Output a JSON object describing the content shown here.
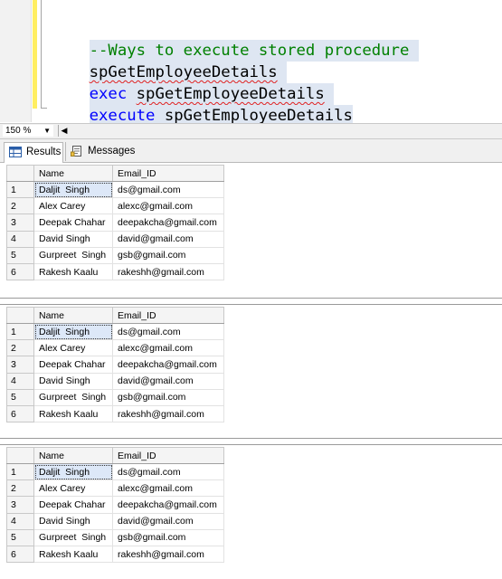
{
  "editor": {
    "lines": {
      "comment": "--Ways to execute stored procedure",
      "line2_proc": "spGetEmployeeDetails",
      "line3_kw": "exec",
      "line3_proc": "spGetEmployeeDetails",
      "line4_kw": "execute",
      "line4_proc": "spGetEmployeeDetails"
    }
  },
  "zoom": {
    "value": "150 %"
  },
  "tabs": {
    "results": "Results",
    "messages": "Messages"
  },
  "grids": {
    "columns": [
      "Name",
      "Email_ID"
    ],
    "g1": {
      "rows": [
        {
          "n": "1",
          "name": "Daljit  Singh",
          "email": "ds@gmail.com"
        },
        {
          "n": "2",
          "name": "Alex Carey",
          "email": "alexc@gmail.com"
        },
        {
          "n": "3",
          "name": "Deepak Chahar",
          "email": "deepakcha@gmail.com"
        },
        {
          "n": "4",
          "name": "David Singh",
          "email": "david@gmail.com"
        },
        {
          "n": "5",
          "name": "Gurpreet  Singh",
          "email": "gsb@gmail.com"
        },
        {
          "n": "6",
          "name": "Rakesh Kaalu",
          "email": "rakeshh@gmail.com"
        }
      ]
    },
    "g2": {
      "rows": [
        {
          "n": "1",
          "name": "Daljit  Singh",
          "email": "ds@gmail.com"
        },
        {
          "n": "2",
          "name": "Alex Carey",
          "email": "alexc@gmail.com"
        },
        {
          "n": "3",
          "name": "Deepak Chahar",
          "email": "deepakcha@gmail.com"
        },
        {
          "n": "4",
          "name": "David Singh",
          "email": "david@gmail.com"
        },
        {
          "n": "5",
          "name": "Gurpreet  Singh",
          "email": "gsb@gmail.com"
        },
        {
          "n": "6",
          "name": "Rakesh Kaalu",
          "email": "rakeshh@gmail.com"
        }
      ]
    },
    "g3": {
      "rows": [
        {
          "n": "1",
          "name": "Daljit  Singh",
          "email": "ds@gmail.com"
        },
        {
          "n": "2",
          "name": "Alex Carey",
          "email": "alexc@gmail.com"
        },
        {
          "n": "3",
          "name": "Deepak Chahar",
          "email": "deepakcha@gmail.com"
        },
        {
          "n": "4",
          "name": "David Singh",
          "email": "david@gmail.com"
        },
        {
          "n": "5",
          "name": "Gurpreet  Singh",
          "email": "gsb@gmail.com"
        },
        {
          "n": "6",
          "name": "Rakesh Kaalu",
          "email": "rakeshh@gmail.com"
        }
      ]
    }
  },
  "icons": {
    "results_tab": "grid-icon",
    "messages_tab": "messages-icon"
  }
}
